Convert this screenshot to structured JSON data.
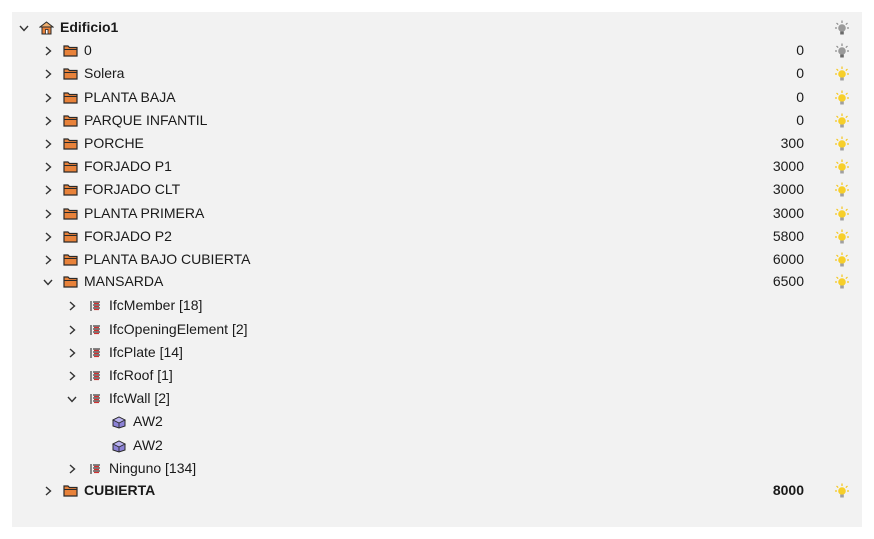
{
  "tree": {
    "root": {
      "label": "Edificio1",
      "bulb": "off"
    },
    "storeys_before": [
      {
        "label": "0",
        "elevation": "0",
        "bulb": "off"
      },
      {
        "label": "Solera",
        "elevation": "0",
        "bulb": "on"
      },
      {
        "label": "PLANTA BAJA",
        "elevation": "0",
        "bulb": "on"
      },
      {
        "label": "PARQUE INFANTIL",
        "elevation": "0",
        "bulb": "on"
      },
      {
        "label": "PORCHE",
        "elevation": "300",
        "bulb": "on"
      },
      {
        "label": "FORJADO P1",
        "elevation": "3000",
        "bulb": "on"
      },
      {
        "label": "FORJADO CLT",
        "elevation": "3000",
        "bulb": "on"
      },
      {
        "label": "PLANTA PRIMERA",
        "elevation": "3000",
        "bulb": "on"
      },
      {
        "label": "FORJADO P2",
        "elevation": "5800",
        "bulb": "on"
      },
      {
        "label": "PLANTA BAJO CUBIERTA",
        "elevation": "6000",
        "bulb": "on"
      }
    ],
    "expanded_storey": {
      "label": "MANSARDA",
      "elevation": "6500",
      "bulb": "on",
      "groups": [
        {
          "label": "IfcMember [18]",
          "expanded": false
        },
        {
          "label": "IfcOpeningElement [2]",
          "expanded": false
        },
        {
          "label": "IfcPlate [14]",
          "expanded": false
        },
        {
          "label": "IfcRoof [1]",
          "expanded": false
        },
        {
          "label": "IfcWall [2]",
          "expanded": true,
          "children": [
            "AW2",
            "AW2"
          ]
        },
        {
          "label": "Ninguno [134]",
          "expanded": false
        }
      ]
    },
    "last_storey": {
      "label": "CUBIERTA",
      "elevation": "8000",
      "bulb": "on"
    }
  },
  "colors": {
    "panel_bg": "#f2f2f2",
    "folder_fill": "#e8823a",
    "folder_outline": "#2a2a2a",
    "bulb_on": "#f5c518",
    "bulb_off": "#8a8a8a",
    "element_icon": "#7b6fc4"
  }
}
